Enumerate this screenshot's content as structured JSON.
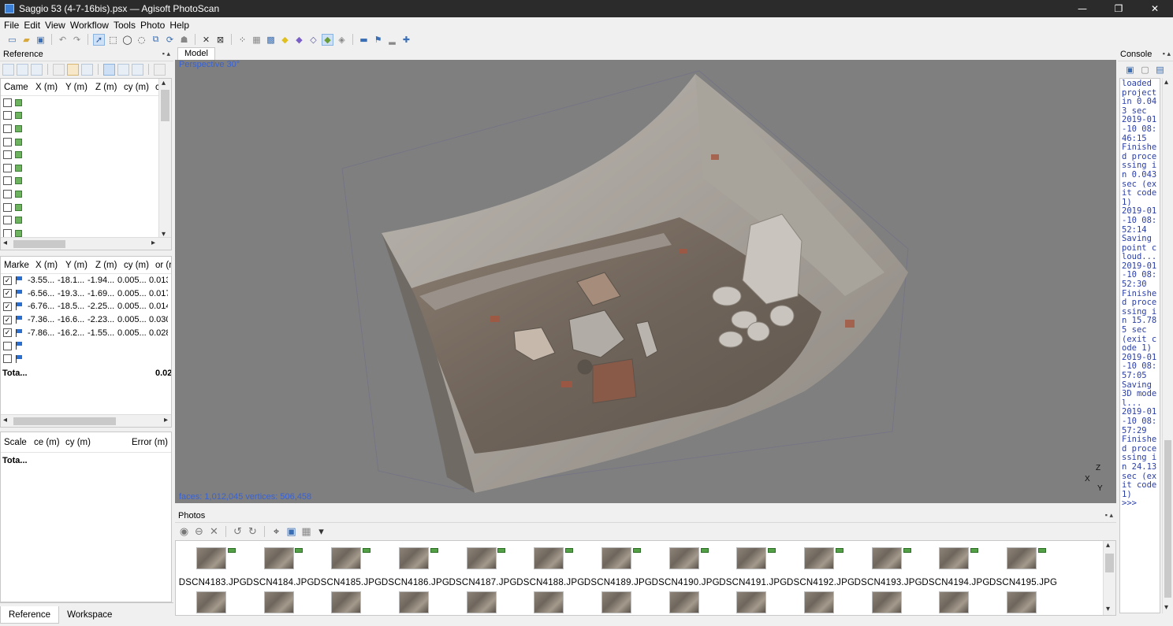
{
  "window": {
    "title": "Saggio 53 (4-7-16bis).psx — Agisoft PhotoScan",
    "minimize": "—",
    "restore": "❐",
    "close": "✕"
  },
  "menu": [
    "File",
    "Edit",
    "View",
    "Workflow",
    "Tools",
    "Photo",
    "Help"
  ],
  "reference": {
    "title": "Reference",
    "cameras": {
      "headers": [
        "Came",
        "X (m)",
        "Y (m)",
        "Z (m)",
        "cy (m)",
        "c"
      ],
      "row_count": 11
    },
    "markers": {
      "headers": [
        "Marke",
        "X (m)",
        "Y (m)",
        "Z (m)",
        "cy (m)",
        "or (r"
      ],
      "rows": [
        {
          "checked": true,
          "x": "-3.55...",
          "y": "-18.1...",
          "z": "-1.94...",
          "acc": "0.005...",
          "err": "0.013"
        },
        {
          "checked": true,
          "x": "-6.56...",
          "y": "-19.3...",
          "z": "-1.69...",
          "acc": "0.005...",
          "err": "0.017"
        },
        {
          "checked": true,
          "x": "-6.76...",
          "y": "-18.5...",
          "z": "-2.25...",
          "acc": "0.005...",
          "err": "0.014"
        },
        {
          "checked": true,
          "x": "-7.36...",
          "y": "-16.6...",
          "z": "-2.23...",
          "acc": "0.005...",
          "err": "0.030"
        },
        {
          "checked": true,
          "x": "-7.86...",
          "y": "-16.2...",
          "z": "-1.55...",
          "acc": "0.005...",
          "err": "0.028"
        },
        {
          "checked": false,
          "x": "",
          "y": "",
          "z": "",
          "acc": "",
          "err": ""
        },
        {
          "checked": false,
          "x": "",
          "y": "",
          "z": "",
          "acc": "",
          "err": ""
        }
      ],
      "total_label": "Tota...",
      "total_value": "0.02"
    },
    "scalebars": {
      "headers": [
        "Scale",
        "ce (m)",
        "cy (m)",
        "Error (m)"
      ],
      "total_label": "Tota..."
    }
  },
  "bottom_tabs": [
    "Reference",
    "Workspace"
  ],
  "model": {
    "tab": "Model",
    "projection": "Perspective 30°",
    "stats": "faces: 1,012,045 vertices: 506,458",
    "axis_x": "X",
    "axis_y": "Y",
    "axis_z": "Z"
  },
  "photos": {
    "title": "Photos",
    "row1": [
      "DSCN4183.JPG",
      "DSCN4184.JPG",
      "DSCN4185.JPG",
      "DSCN4186.JPG",
      "DSCN4187.JPG",
      "DSCN4188.JPG",
      "DSCN4189.JPG",
      "DSCN4190.JPG",
      "DSCN4191.JPG",
      "DSCN4192.JPG",
      "DSCN4193.JPG",
      "DSCN4194.JPG",
      "DSCN4195.JPG"
    ],
    "row2_count": 13
  },
  "console": {
    "title": "Console",
    "text": "loaded project in 0.043 sec\n2019-01-10 08:46:15\nFinished processing in 0.043 sec (exit code 1)\n2019-01-10 08:52:14\nSaving point cloud...\n2019-01-10 08:52:30\nFinished processing in 15.785 sec (exit code 1)\n2019-01-10 08:57:05\nSaving 3D model...\n2019-01-10 08:57:29\nFinished processing in 24.13 sec (exit code 1)\n>>>"
  },
  "colors": {
    "titlebar": "#2b2b2b",
    "viewport_bg": "#7f7f7f",
    "overlay_text": "#3a62d0",
    "console_text": "#2a3ea8"
  }
}
